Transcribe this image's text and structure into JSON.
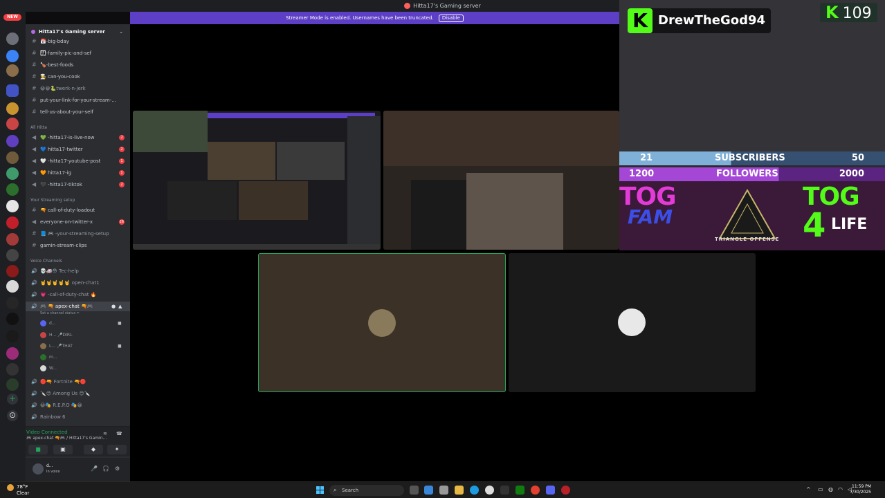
{
  "window": {
    "title": "Hitta17's Gaming server"
  },
  "banner": {
    "text": "Streamer Mode is enabled. Usernames have been truncated.",
    "button": "Disable"
  },
  "rail": {
    "new_label": "NEW"
  },
  "server": {
    "name": "Hitta17's Gaming server"
  },
  "channels_top": [
    {
      "label": "📅-big-bday",
      "badge": ""
    },
    {
      "label": "👨‍👩‍👧-family-pic-and-sef",
      "badge": ""
    },
    {
      "label": "🍗-best-foods",
      "badge": ""
    },
    {
      "label": "👨‍🍳 can-you-cook",
      "badge": ""
    },
    {
      "label": "😀😀🐍twerk-n-jerk",
      "badge": ""
    },
    {
      "label": "put-your-link-for-your-stream-...",
      "badge": ""
    },
    {
      "label": "tell-us-about-your-self",
      "badge": ""
    }
  ],
  "categories": {
    "all": "All Hitta",
    "setup": "Your Streaming setup",
    "voice": "Voice Channels"
  },
  "channels_all": [
    {
      "label": "💚 -hitta17-is-live-now",
      "badge": "2"
    },
    {
      "label": "💙 hitta17-twitter",
      "badge": "2"
    },
    {
      "label": "🤍 -hitta17-youtube-post",
      "badge": "1"
    },
    {
      "label": "🧡 hitta17-ig",
      "badge": "1"
    },
    {
      "label": "🖤 -hitta17-tiktok",
      "badge": "2"
    }
  ],
  "channels_setup": [
    {
      "label": "🔫 call-of-duty-loadout",
      "badge": ""
    },
    {
      "label": "everyone-on-twitter-x",
      "badge": "26"
    },
    {
      "label": "📘 🎮 -your-streaming-setup",
      "badge": ""
    },
    {
      "label": "gamin-stream-clips",
      "badge": ""
    }
  ],
  "voice_channels": [
    {
      "label": "💀🚑😳 Tec-help"
    },
    {
      "label": "🤘🤘🤘🤘🤘 open-chat1"
    },
    {
      "label": "💗 -call-of-duty-chat 🔥"
    }
  ],
  "active_voice": {
    "label": "🎮 🔫 apex-chat 🔫🎮",
    "status": "Set a channel status ✏"
  },
  "voice_users": [
    {
      "name": "d..."
    },
    {
      "name": "H... 🎤DIRL"
    },
    {
      "name": "L... 🎤THAT"
    },
    {
      "name": "m..."
    },
    {
      "name": "W..."
    }
  ],
  "voice_more": [
    {
      "label": "🔴🔫 Fortnite 🔫🔴"
    },
    {
      "label": "🔪😊 Among Us 😊🔪"
    },
    {
      "label": "😀🎭 R.E.P.O 🎭😀"
    },
    {
      "label": "Rainbow 6"
    }
  ],
  "voice_panel": {
    "connected": "Video Connected",
    "sub": "🎮 apex-chat 🔫🎮 / Hitta17's Gamin..."
  },
  "user_panel": {
    "name": "d...",
    "status": "In voice"
  },
  "overlay": {
    "name": "DrewTheGod94",
    "viewers": "109",
    "sub_current": "21",
    "sub_label": "SUBSCRIBERS",
    "sub_goal": "50",
    "fol_current": "1200",
    "fol_label": "FOLLOWERS",
    "fol_goal": "2000",
    "tog_left": "TOG",
    "fam": "FAM",
    "triangle": "TRIANGLE OFFENSE",
    "tog_right": "TOG",
    "four": "4",
    "life": "LIFE"
  },
  "taskbar": {
    "temp": "78°F",
    "cond": "Clear",
    "search": "Search",
    "time": "11:59 PM",
    "date": "7/30/2025"
  }
}
